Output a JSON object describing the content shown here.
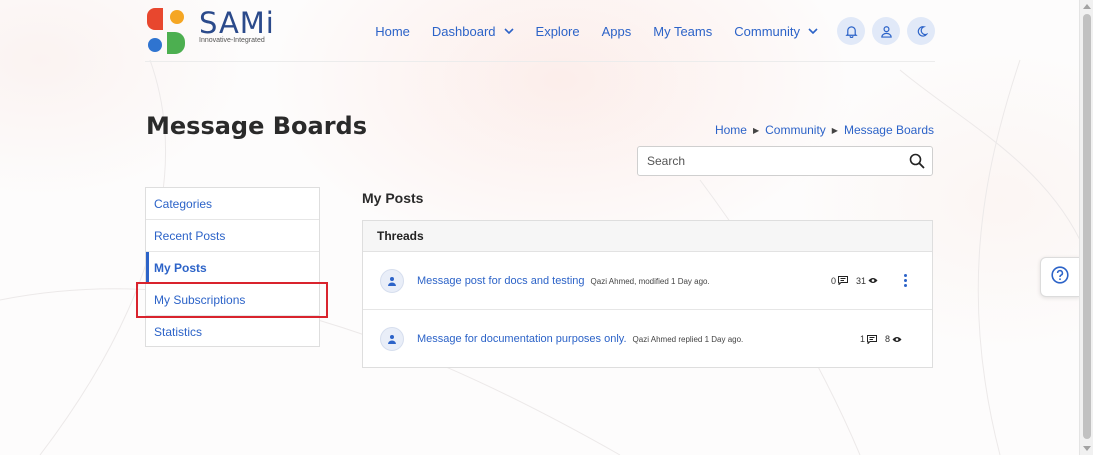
{
  "brand": {
    "name": "SAMi",
    "tagline": "Innovative-Integrated",
    "colors": {
      "red": "#e8472e",
      "orange": "#f5a623",
      "blue": "#2f74d0",
      "green": "#4caf50",
      "text": "#2b4a8b"
    }
  },
  "nav": {
    "home": "Home",
    "dashboard": "Dashboard",
    "explore": "Explore",
    "apps": "Apps",
    "my_teams": "My Teams",
    "community": "Community",
    "icons": [
      "bell-icon",
      "user-icon",
      "moon-icon"
    ]
  },
  "page": {
    "title": "Message Boards",
    "breadcrumb": [
      "Home",
      "Community",
      "Message Boards"
    ]
  },
  "search": {
    "placeholder": "Search",
    "value": ""
  },
  "sidebar": {
    "items": [
      {
        "label": "Categories",
        "active": false
      },
      {
        "label": "Recent Posts",
        "active": false
      },
      {
        "label": "My Posts",
        "active": true
      },
      {
        "label": "My Subscriptions",
        "active": false
      },
      {
        "label": "Statistics",
        "active": false
      }
    ]
  },
  "main": {
    "title": "My Posts",
    "threads_header": "Threads",
    "threads": [
      {
        "title": "Message post for docs and testing",
        "meta": "Qazi Ahmed, modified 1 Day ago.",
        "replies": "0",
        "views": "31"
      },
      {
        "title": "Message for documentation purposes only.",
        "meta": "Qazi Ahmed replied 1 Day ago.",
        "replies": "1",
        "views": "8"
      }
    ]
  },
  "accent_color": "#2c63c8",
  "highlight_color": "#d9232d"
}
